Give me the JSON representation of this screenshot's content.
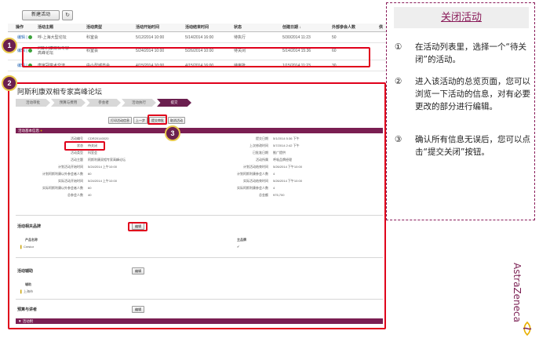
{
  "list": {
    "new_button": "新建活动",
    "refresh_icon": "refresh-icon",
    "headers": [
      "操作",
      "活动主题",
      "活动类型",
      "活动开始时间",
      "活动结束时间",
      "状态",
      "创建日期 ↓",
      "外部参会人数",
      "供"
    ],
    "rows": [
      {
        "action": "编辑 |",
        "topic": "呼-上海大型论坛",
        "type": "科室会",
        "start": "5/12/2014 10:00",
        "end": "5/14/2014 16:00",
        "status": "待执行",
        "created": "5/30/2014 11:23",
        "external": "50"
      },
      {
        "action": "编辑 |",
        "topic": "阿斯利康双相专家高峰论坛",
        "type": "科室会",
        "start": "5/24/2014 10:00",
        "end": "5/26/2014 10:00",
        "status": "待关闭",
        "created": "5/14/2014 15:36",
        "external": "60"
      },
      {
        "action": "编辑 |",
        "topic": "唐家冠学术交流",
        "type": "中小型城市会",
        "start": "4/15/2014 10:00",
        "end": "4/15/2014 16:00",
        "status": "待审批",
        "created": "1/15/2014 11:23",
        "external": "30"
      }
    ]
  },
  "detail": {
    "title": "阿斯利康双相专家高峰论坛",
    "steps": [
      "活动审批",
      "预算与费用",
      "参会者",
      "活动执行",
      "提交"
    ],
    "buttons": [
      "打印活动信息",
      "上一步",
      "提交审批",
      "取消活动"
    ],
    "section_info": "活动基本信息",
    "fields_left": [
      {
        "label": "活动编号",
        "value": "CDR20140020"
      },
      {
        "label": "状态",
        "value": "待关闭"
      },
      {
        "label": "活动类型",
        "value": "科室会"
      },
      {
        "label": "活动主题",
        "value": "阿斯利康双相专家高峰论坛"
      },
      {
        "label": "计划活动开始时间",
        "value": "5/24/2014 上午10:00"
      },
      {
        "label": "计划阿斯利康以外参会者人数",
        "value": "60"
      },
      {
        "label": "实际活动开始时间",
        "value": "5/24/2014 上午10:00"
      },
      {
        "label": "实际阿斯利康以外参会者人数",
        "value": "60"
      },
      {
        "label": "总参会人数",
        "value": "40"
      }
    ],
    "fields_right": [
      {
        "label": "提交日期",
        "value": "5/1/2014 5:36 下午"
      },
      {
        "label": "上次修改时间",
        "value": "5/7/2014 2:42 下午"
      },
      {
        "label": "已批准日期",
        "value": "推广提供"
      },
      {
        "label": "活动所属",
        "value": "呼吸品牌经理"
      },
      {
        "label": "计划活动结束时间",
        "value": "5/26/2014 下午10:00"
      },
      {
        "label": "计划阿斯利康参会人数",
        "value": "4"
      },
      {
        "label": "实际活动结束时间",
        "value": "5/26/2014 下午10:00"
      },
      {
        "label": "实际阿斯利康参会人数",
        "value": "4"
      },
      {
        "label": "总金额",
        "value": "¥75,700"
      }
    ],
    "brands_title": "活动相关品牌",
    "brands_edit": "编辑",
    "brands_cols": [
      "产品名称",
      "主品牌"
    ],
    "brands_row": {
      "name": "Crestor",
      "primary": "✔"
    },
    "vendor_title": "活动辅助",
    "vendor_edit": "编辑",
    "vendor_col": "辅助",
    "vendor_row": "上海市",
    "speakers_title": "预算与讲者",
    "speakers_edit": "编辑",
    "footer_bar": "▼ 活动附"
  },
  "badges": [
    "1",
    "2",
    "3"
  ],
  "instructions": {
    "title": "关闭活动",
    "items": [
      {
        "num": "①",
        "text": "在活动列表里，选择一个“待关闭”的活动。"
      },
      {
        "num": "②",
        "text": "进入该活动的总览页面，您可以浏览一下活动的信息，对有必要更改的部分进行编辑。"
      },
      {
        "num": "③",
        "text": "确认所有信息无误后，您可以点击“提交关闭”按钮。"
      }
    ]
  },
  "logo": "AstraZeneca",
  "colors": {
    "accent": "#6b1f4f",
    "highlight": "#e0001b",
    "badge_ring": "#e8c84a"
  }
}
